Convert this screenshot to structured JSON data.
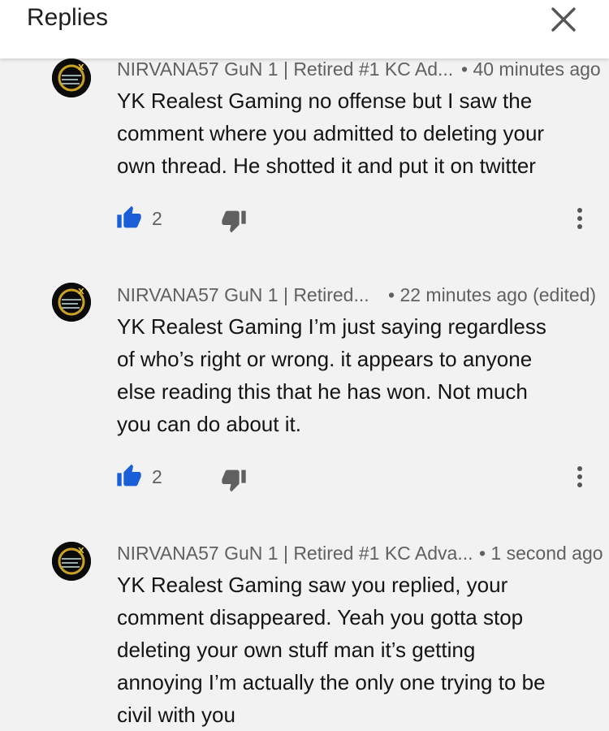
{
  "header": {
    "title": "Replies",
    "close_icon": "close-icon"
  },
  "colors": {
    "like_active": "#1a5ed8",
    "dislike": "#606060",
    "meta_text": "#606060",
    "body_text": "#141414",
    "background": "#f2f2f2"
  },
  "comments": [
    {
      "author": "NIRVANA57 GuN 1 | Retired #1 KC Ad...",
      "time": "• 40 minutes ago",
      "lines": [
        "YK Realest Gaming no offense but I saw the",
        "comment where you admitted to deleting your",
        "own thread. He shotted it and put it on twitter"
      ],
      "likes": "2"
    },
    {
      "author": "NIRVANA57 GuN 1 | Retired...",
      "time": "• 22 minutes ago (edited)",
      "lines": [
        "YK Realest Gaming I’m just saying regardless",
        "of who’s right or wrong. it appears to anyone",
        "else reading this that he has won. Not much",
        "you can do about it."
      ],
      "likes": "2"
    },
    {
      "author": "NIRVANA57 GuN 1 | Retired #1 KC Adva...",
      "time": "• 1 second ago",
      "lines": [
        "YK Realest Gaming saw you replied, your",
        "comment disappeared. Yeah you gotta stop",
        "deleting your own stuff man it’s getting",
        "annoying I’m actually the only one trying to be",
        "civil with you"
      ]
    }
  ]
}
